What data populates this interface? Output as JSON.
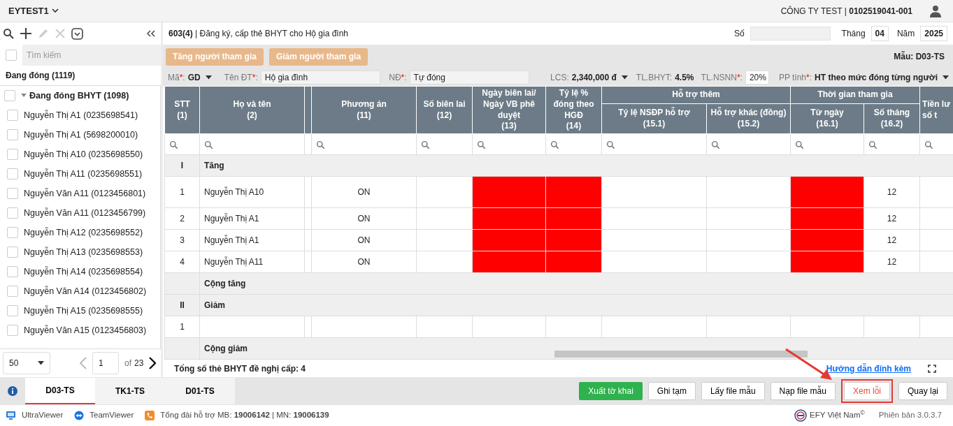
{
  "app": {
    "account": "EYTEST1",
    "company": "CÔNG TY TEST | **0102519041-001**"
  },
  "sidebar": {
    "toolbar": [
      {
        "kind": "search",
        "disabled": false
      },
      {
        "kind": "add",
        "disabled": false
      },
      {
        "kind": "edit",
        "disabled": true
      },
      {
        "kind": "delete",
        "disabled": true
      },
      {
        "kind": "dropdown",
        "disabled": false
      },
      {
        "kind": "collapse",
        "disabled": false
      }
    ],
    "search": {
      "placeholder": "Tìm kiếm",
      "checked": false
    },
    "heading": "Đang đóng (1119)",
    "tree": [
      {
        "label": "Đang đóng BHYT (1098)",
        "checked": false,
        "expanded": true,
        "children": [
          {
            "label": "Nguyễn Thị A1 (0235698541)",
            "checked": false
          },
          {
            "label": "Nguyễn Thị A1 (5698200010)",
            "checked": false
          },
          {
            "label": "Nguyễn Thị A10 (0235698550)",
            "checked": false
          },
          {
            "label": "Nguyễn Thị A11 (0235698551)",
            "checked": false
          },
          {
            "label": "Nguyễn Văn A11 (0123456801)",
            "checked": false
          },
          {
            "label": "Nguyễn Văn A11 (0123456799)",
            "checked": false
          },
          {
            "label": "Nguyễn Thị A12 (0235698552)",
            "checked": false
          },
          {
            "label": "Nguyễn Thị A13 (0235698553)",
            "checked": false
          },
          {
            "label": "Nguyễn Thị A14 (0235698554)",
            "checked": false
          },
          {
            "label": "Nguyễn Văn A14 (0123456802)",
            "checked": false
          },
          {
            "label": "Nguyễn Thị A15 (0235698555)",
            "checked": false
          },
          {
            "label": "Nguyễn Văn A15 (0123456803)",
            "checked": false
          }
        ]
      }
    ],
    "pagination": {
      "page_size": "50",
      "page": "1",
      "of": "of",
      "total": "23",
      "prev_disabled": true
    }
  },
  "form": {
    "title": "**603(4)** | Đăng ký, cấp thẻ BHYT cho Hộ gia đình",
    "number": {
      "label": "Số"
    },
    "month": {
      "label": "Tháng",
      "value": "04"
    },
    "year": {
      "label": "Năm",
      "value": "2025"
    },
    "actions": [
      "Tăng người tham gia",
      "Giảm người tham gia"
    ],
    "template": "Mẫu: D03-TS",
    "required_mark": "*",
    "label_suffix": ":",
    "params": [
      {
        "kind": "select",
        "label": "Mã",
        "required": true,
        "value": "GD"
      },
      {
        "kind": "input",
        "label": "Tên ĐT",
        "required": true,
        "value": "Hộ gia đình"
      },
      {
        "kind": "input",
        "label": "NĐ",
        "required": true,
        "value": "Tự đóng"
      },
      {
        "kind": "select",
        "label": "LCS",
        "required": false,
        "value": "2,340,000 đ"
      },
      {
        "kind": "text",
        "label": "TL.BHYT",
        "required": false,
        "value": "4.5%"
      },
      {
        "kind": "input_short",
        "label": "TL.NSNN",
        "required": true,
        "value": "20%"
      },
      {
        "kind": "select",
        "label": "PP tính",
        "required": true,
        "value": "HT theo mức đóng từng người"
      }
    ]
  },
  "table": {
    "columns": [
      {
        "kind": "single",
        "lines": [
          "STT",
          "(1)"
        ]
      },
      {
        "kind": "single",
        "lines": [
          "Họ và tên",
          "(2)"
        ]
      },
      {
        "kind": "collapsed"
      },
      {
        "kind": "single",
        "lines": [
          "Phương án",
          "(11)"
        ]
      },
      {
        "kind": "single",
        "lines": [
          "Số biên lai",
          "(12)"
        ]
      },
      {
        "kind": "single",
        "lines": [
          "Ngày biên lai/ Ngày VB phê duyệt",
          "(13)"
        ]
      },
      {
        "kind": "single",
        "lines": [
          "Tỷ lệ % đóng theo HGĐ",
          "(14)"
        ]
      },
      {
        "kind": "group",
        "label": "Hỗ trợ thêm",
        "children": [
          {
            "lines": [
              "Tỷ lệ NSĐP hỗ trợ",
              "(15.1)"
            ]
          },
          {
            "lines": [
              "Hỗ trợ khác (đồng)",
              "(15.2)"
            ]
          }
        ]
      },
      {
        "kind": "group",
        "label": "Thời gian tham gia",
        "children": [
          {
            "lines": [
              "Từ ngày",
              "(16.1)"
            ]
          },
          {
            "lines": [
              "Số tháng",
              "(16.2)"
            ]
          }
        ]
      },
      {
        "kind": "single",
        "lines": [
          "Tiền lư",
          "số t"
        ]
      }
    ],
    "rows": [
      {
        "kind": "section",
        "stt": "I",
        "label": "Tăng"
      },
      {
        "kind": "data",
        "cells": [
          {
            "text": "1",
            "error": false
          },
          {
            "text": "Nguyễn Thị A10",
            "error": false
          },
          {
            "error": false
          },
          {
            "text": "ON",
            "error": false
          },
          {
            "error": false
          },
          {
            "error": true
          },
          {
            "error": true
          },
          {
            "error": false
          },
          {
            "error": false
          },
          {
            "error": true
          },
          {
            "text": "12",
            "error": false
          },
          {
            "error": false
          }
        ]
      },
      {
        "kind": "data",
        "cells": [
          {
            "text": "2",
            "error": false
          },
          {
            "text": "Nguyễn Thị A1",
            "error": false
          },
          {
            "error": false
          },
          {
            "text": "ON",
            "error": false
          },
          {
            "error": false
          },
          {
            "error": true
          },
          {
            "error": true
          },
          {
            "error": false
          },
          {
            "error": false
          },
          {
            "error": true
          },
          {
            "text": "12",
            "error": false
          },
          {
            "error": false
          }
        ]
      },
      {
        "kind": "data",
        "cells": [
          {
            "text": "3",
            "error": false
          },
          {
            "text": "Nguyễn Thị A1",
            "error": false
          },
          {
            "error": false
          },
          {
            "text": "ON",
            "error": false
          },
          {
            "error": false
          },
          {
            "error": true
          },
          {
            "error": true
          },
          {
            "error": false
          },
          {
            "error": false
          },
          {
            "error": true
          },
          {
            "text": "12",
            "error": false
          },
          {
            "error": false
          }
        ]
      },
      {
        "kind": "data",
        "cells": [
          {
            "text": "4",
            "error": false
          },
          {
            "text": "Nguyễn Thị A11",
            "error": false
          },
          {
            "error": false
          },
          {
            "text": "ON",
            "error": false
          },
          {
            "error": false
          },
          {
            "error": true
          },
          {
            "error": true
          },
          {
            "error": false
          },
          {
            "error": false
          },
          {
            "error": true
          },
          {
            "text": "12",
            "error": false
          },
          {
            "error": false
          }
        ]
      },
      {
        "kind": "subtotal",
        "label": "Cộng tăng"
      },
      {
        "kind": "section",
        "stt": "II",
        "label": "Giảm"
      },
      {
        "kind": "data",
        "cells": [
          {
            "text": "1",
            "error": false
          },
          {
            "error": false
          },
          {
            "error": false
          },
          {
            "error": false
          },
          {
            "error": false
          },
          {
            "error": false
          },
          {
            "error": false
          },
          {
            "error": false
          },
          {
            "error": false
          },
          {
            "error": false
          },
          {
            "error": false
          },
          {
            "error": false
          }
        ]
      },
      {
        "kind": "subtotal",
        "label": "Cộng giảm"
      }
    ]
  },
  "summary": "Tổng số thẻ BHYT đề nghị cấp: 4",
  "guide_link": "Hướng dẫn đính kèm",
  "bottom_tabs": [
    {
      "label": "D03-TS",
      "selected": true
    },
    {
      "label": "TK1-TS",
      "selected": false
    },
    {
      "label": "D01-TS",
      "selected": false
    }
  ],
  "buttons": [
    {
      "label": "Xuất tờ khai",
      "kind": "primary",
      "highlighted": false
    },
    {
      "label": "Ghi tạm",
      "kind": "default",
      "highlighted": false
    },
    {
      "label": "Lấy file mẫu",
      "kind": "default",
      "highlighted": false
    },
    {
      "label": "Nạp file mẫu",
      "kind": "default",
      "highlighted": false
    },
    {
      "label": "Xem lỗi",
      "kind": "danger",
      "highlighted": true
    },
    {
      "label": "Quay lại",
      "kind": "default",
      "highlighted": false
    }
  ],
  "footer": {
    "items": [
      {
        "kind": "ultraviewer",
        "label": "UltraViewer"
      },
      {
        "kind": "teamviewer",
        "label": "TeamViewer"
      },
      {
        "kind": "phone",
        "label": "Tổng đài hỗ trợ MB: **19006142** | MN: **19006139**"
      }
    ],
    "brand": "EFY Việt Nam$^{©}$",
    "version": "Phiên bản 3.0.3.7"
  }
}
